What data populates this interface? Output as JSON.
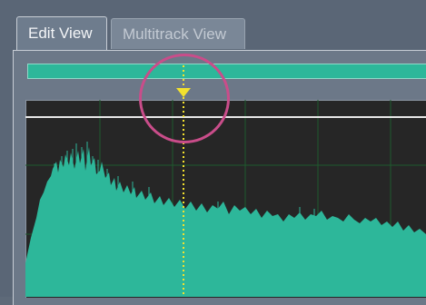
{
  "tabs": [
    {
      "label": "Edit View",
      "active": true
    },
    {
      "label": "Multitrack View",
      "active": false
    }
  ],
  "colors": {
    "waveform": "#2db79a",
    "background": "#262626",
    "grid": "#1f5a2e",
    "playhead": "#f3e12e",
    "highlight": "#c94d8a"
  }
}
